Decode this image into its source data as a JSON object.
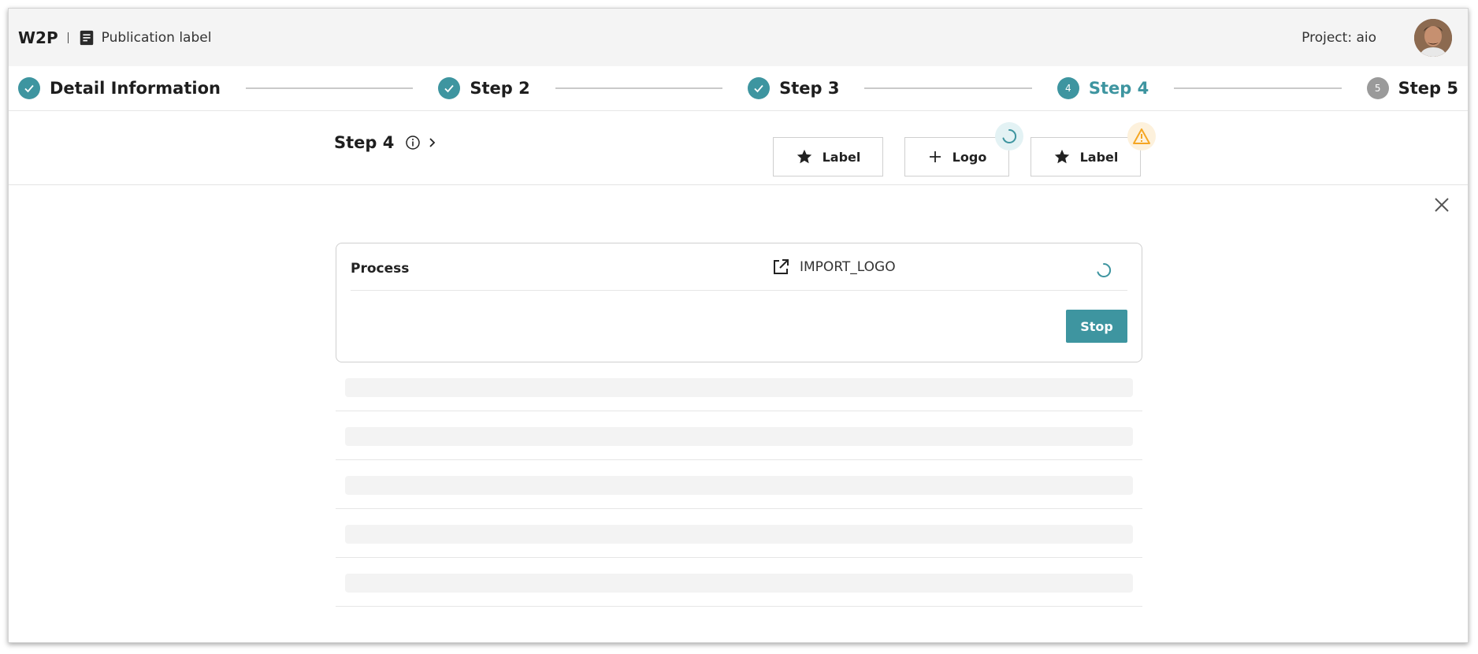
{
  "header": {
    "brand": "W2P",
    "separator": "|",
    "page_label": "Publication label",
    "project": "Project: aio"
  },
  "stepper": {
    "steps": [
      {
        "label": "Detail Information",
        "state": "done"
      },
      {
        "label": "Step 2",
        "state": "done"
      },
      {
        "label": "Step 3",
        "state": "done"
      },
      {
        "label": "Step 4",
        "state": "active",
        "number": "4"
      },
      {
        "label": "Step 5",
        "state": "pending",
        "number": "5"
      }
    ]
  },
  "toolbar": {
    "title": "Step 4",
    "buttons": [
      {
        "label": "Label",
        "icon": "star-icon"
      },
      {
        "label": "Logo",
        "icon": "plus-icon",
        "badge": "spinner"
      },
      {
        "label": "Label",
        "icon": "star-icon",
        "badge": "warning"
      }
    ]
  },
  "process": {
    "label": "Process",
    "task": "IMPORT_LOGO",
    "stop_label": "Stop"
  },
  "colors": {
    "accent": "#3e95a0",
    "warning": "#f5a623",
    "pending": "#9a9a9a"
  }
}
